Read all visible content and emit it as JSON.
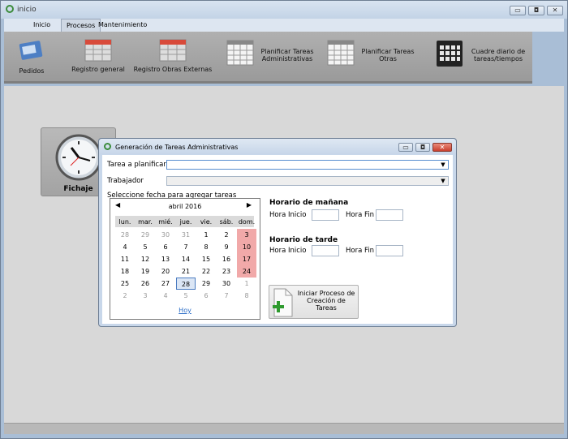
{
  "window": {
    "title": "inicio"
  },
  "menu": {
    "items": [
      "Inicio",
      "Procesos",
      "Mantenimiento"
    ],
    "active": "Procesos"
  },
  "ribbon": {
    "pedidos": "Pedidos",
    "registro_general": "Registro general",
    "registro_obras": "Registro Obras Externas",
    "planificar_admin_1": "Planificar Tareas",
    "planificar_admin_2": "Administrativas",
    "planificar_otras_1": "Planificar Tareas",
    "planificar_otras_2": "Otras",
    "cuadre_1": "Cuadre diario de",
    "cuadre_2": "tareas/tiempos"
  },
  "fichaje": {
    "label": "Fichaje"
  },
  "dialog": {
    "title": "Generación de Tareas Administrativas",
    "tarea_label": "Tarea a planificar",
    "tarea_value": "",
    "trabajador_label": "Trabajador",
    "trabajador_value": "",
    "select_date_label": "Seleccione fecha para agregar tareas",
    "manana_heading": "Horario de mañana",
    "tarde_heading": "Horario de tarde",
    "hora_inicio": "Hora Inicio",
    "hora_fin": "Hora Fin",
    "generate_line1": "Iniciar Proceso de",
    "generate_line2": "Creación de",
    "generate_line3": "Tareas"
  },
  "calendar": {
    "month": "abril 2016",
    "weekdays": [
      "lun.",
      "mar.",
      "mié.",
      "jue.",
      "vie.",
      "sáb.",
      "dom."
    ],
    "weeks": [
      [
        "28",
        "29",
        "30",
        "31",
        "1",
        "2",
        "3"
      ],
      [
        "4",
        "5",
        "6",
        "7",
        "8",
        "9",
        "10"
      ],
      [
        "11",
        "12",
        "13",
        "14",
        "15",
        "16",
        "17"
      ],
      [
        "18",
        "19",
        "20",
        "21",
        "22",
        "23",
        "24"
      ],
      [
        "25",
        "26",
        "27",
        "28",
        "29",
        "30",
        "1"
      ],
      [
        "2",
        "3",
        "4",
        "5",
        "6",
        "7",
        "8"
      ]
    ],
    "today": "28",
    "hoy": "Hoy"
  },
  "colors": {
    "sunday_bg": "#f1a9a9",
    "accent": "#2a6cc6",
    "ribbon": "#a8a8a8"
  }
}
